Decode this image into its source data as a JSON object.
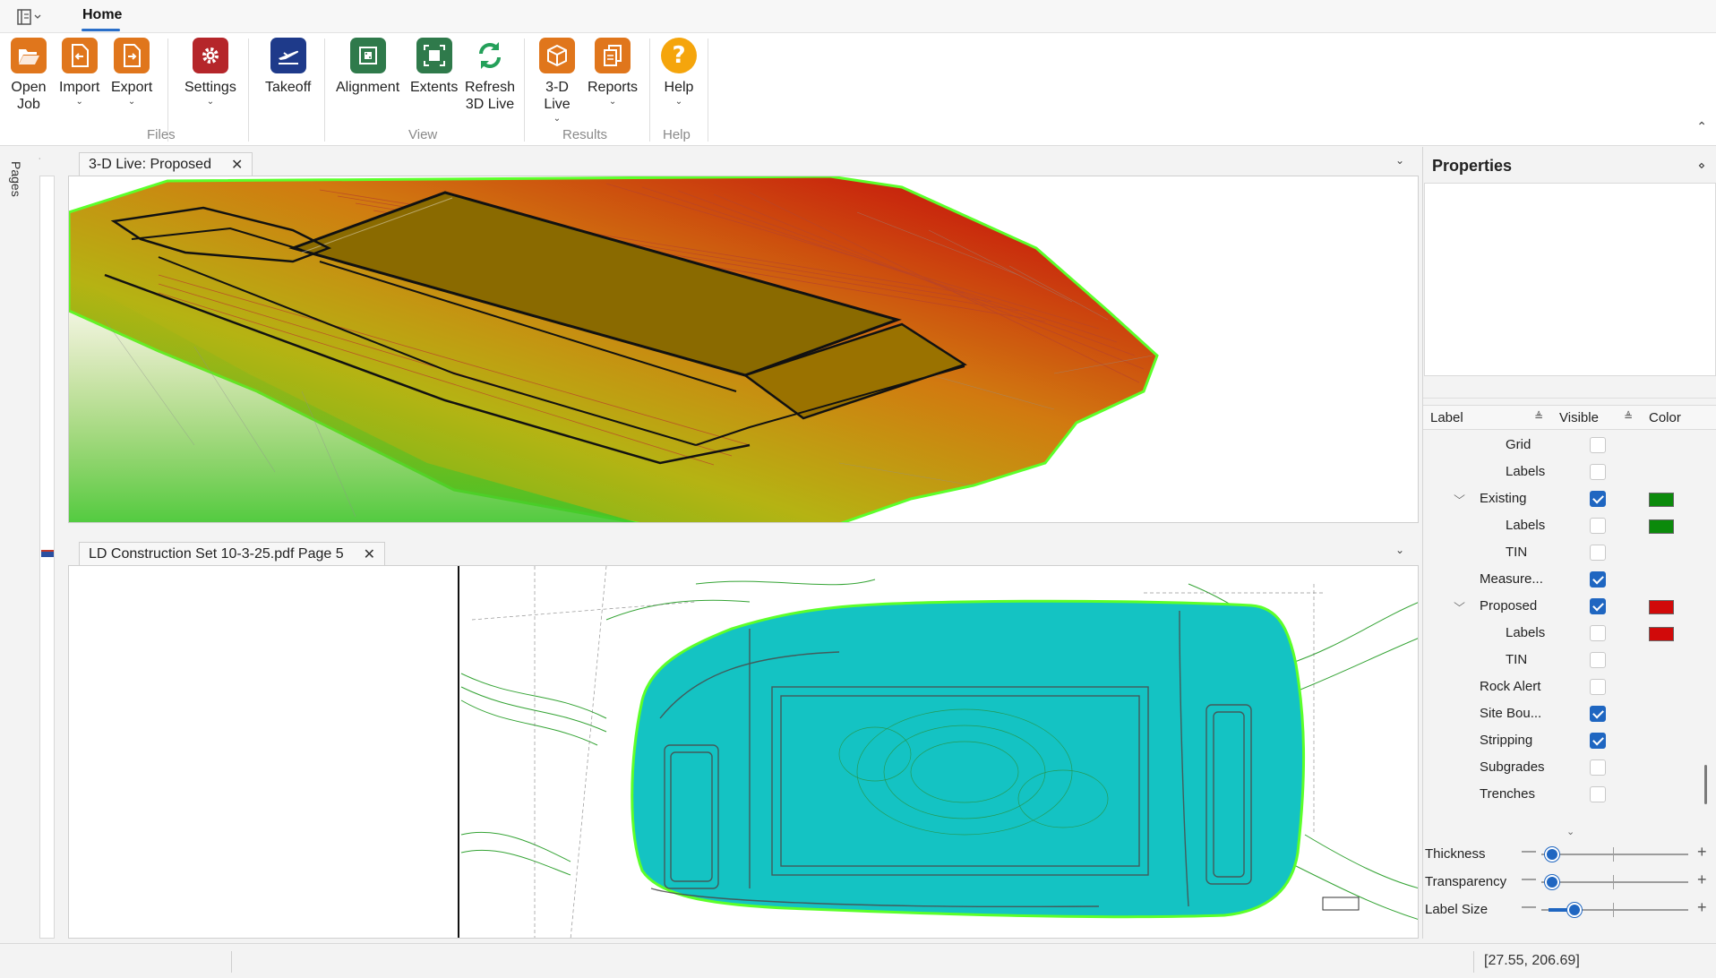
{
  "ribbon_tab": "Home",
  "ribbon": {
    "open_job": "Open\nJob",
    "import": "Import",
    "export": "Export",
    "settings": "Settings",
    "takeoff": "Takeoff",
    "alignment": "Alignment",
    "extents": "Extents",
    "refresh": "Refresh\n3D Live",
    "live3d": "3-D\nLive",
    "reports": "Reports",
    "help": "Help",
    "groups": {
      "files": "Files",
      "view": "View",
      "results": "Results",
      "help": "Help"
    }
  },
  "rail": {
    "pages_label": "Pages"
  },
  "doc_tabs": {
    "top": "3-D Live: Proposed",
    "bottom": "LD Construction Set 10-3-25.pdf Page 5"
  },
  "properties": {
    "title": "Properties",
    "columns": {
      "label": "Label",
      "visible": "Visible",
      "color": "Color"
    },
    "layers": [
      {
        "label": "Grid",
        "indent": 2,
        "visible": false,
        "color": null,
        "expander": false
      },
      {
        "label": "Labels",
        "indent": 2,
        "visible": false,
        "color": null,
        "expander": false
      },
      {
        "label": "Existing",
        "indent": 1,
        "visible": true,
        "color": "#0b8a0b",
        "expander": true
      },
      {
        "label": "Labels",
        "indent": 2,
        "visible": false,
        "color": "#0b8a0b",
        "expander": false
      },
      {
        "label": "TIN",
        "indent": 2,
        "visible": false,
        "color": null,
        "expander": false
      },
      {
        "label": "Measure...",
        "indent": 1,
        "visible": true,
        "color": null,
        "expander": false
      },
      {
        "label": "Proposed",
        "indent": 1,
        "visible": true,
        "color": "#d10a0a",
        "expander": true
      },
      {
        "label": "Labels",
        "indent": 2,
        "visible": false,
        "color": "#d10a0a",
        "expander": false
      },
      {
        "label": "TIN",
        "indent": 2,
        "visible": false,
        "color": null,
        "expander": false
      },
      {
        "label": "Rock Alert",
        "indent": 1,
        "visible": false,
        "color": null,
        "expander": false
      },
      {
        "label": "Site Bou...",
        "indent": 1,
        "visible": true,
        "color": null,
        "expander": false
      },
      {
        "label": "Stripping",
        "indent": 1,
        "visible": true,
        "color": null,
        "expander": false
      },
      {
        "label": "Subgrades",
        "indent": 1,
        "visible": false,
        "color": null,
        "expander": false
      },
      {
        "label": "Trenches",
        "indent": 1,
        "visible": false,
        "color": null,
        "expander": false
      }
    ],
    "sliders": [
      {
        "label": "Thickness",
        "value": 0.0
      },
      {
        "label": "Transparency",
        "value": 0.0
      },
      {
        "label": "Label Size",
        "value": 0.18
      }
    ]
  },
  "status": {
    "coords": "[27.55, 206.69]"
  },
  "colors": {
    "accent": "#1f66c1",
    "surface_proposed": "#8a6a00",
    "pdf_fill": "#14c3c3"
  }
}
